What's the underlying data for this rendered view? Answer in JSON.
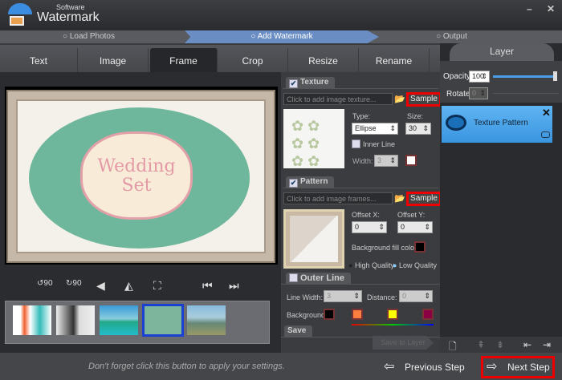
{
  "app": {
    "title_small": "Software",
    "title": "Watermark",
    "minimize": "–",
    "close": "✕"
  },
  "steps": [
    "Load Photos",
    "Add Watermark",
    "Output"
  ],
  "tabs": [
    "Text",
    "Image",
    "Frame",
    "Crop",
    "Resize",
    "Rename"
  ],
  "preview": {
    "text": "Wedding Set"
  },
  "tools": {
    "rotate_left": "90",
    "rotate_right": "90"
  },
  "texture": {
    "label": "Texture",
    "placeholder": "Click to add image texture...",
    "sample": "Sample",
    "type_label": "Type:",
    "type_value": "Ellipse",
    "size_label": "Size:",
    "size_value": "30",
    "inner_line": "Inner Line",
    "width_label": "Width:",
    "width_value": "3"
  },
  "pattern": {
    "label": "Pattern",
    "placeholder": "Click to add image frames...",
    "sample": "Sample",
    "offset_x_label": "Offset X:",
    "offset_x": "0",
    "offset_y_label": "Offset Y:",
    "offset_y": "0",
    "bg_fill": "Background fill color:",
    "high": "High Quality",
    "low": "Low Quality"
  },
  "outer": {
    "label": "Outer Line",
    "line_width_label": "Line Width:",
    "line_width": "3",
    "distance_label": "Distance:",
    "distance": "0",
    "background": "Background",
    "colors": [
      "#000000",
      "#ff7f3f",
      "#ffff00",
      "#8b0045"
    ]
  },
  "save": {
    "label": "Save",
    "button": "Save to Layer"
  },
  "layer": {
    "title": "Layer",
    "opacity_label": "Opacity",
    "opacity": "100",
    "rotate_label": "Rotate",
    "rotate": "0",
    "item": "Texture Pattern"
  },
  "footer": {
    "hint": "Don't forget click this button to apply your settings.",
    "prev": "Previous Step",
    "next": "Next Step"
  }
}
